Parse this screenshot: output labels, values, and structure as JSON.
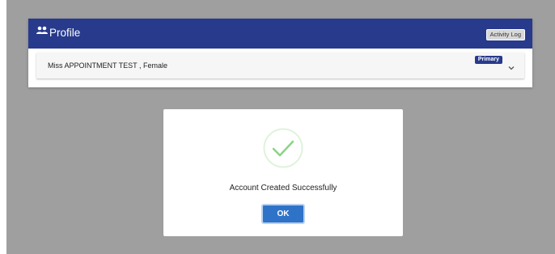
{
  "header": {
    "title": "Profile",
    "icon": "people-icon",
    "activity_log_label": "Activity Log",
    "color": "#273a8c"
  },
  "patient": {
    "summary": "Miss APPOINTMENT TEST , Female",
    "badge": "Primary",
    "expand_icon": "chevron-down-icon"
  },
  "modal": {
    "icon": "check-circle-icon",
    "message": "Account Created Successfully",
    "ok_label": "OK",
    "check_color": "#8bd485",
    "button_color": "#2f73c9"
  }
}
